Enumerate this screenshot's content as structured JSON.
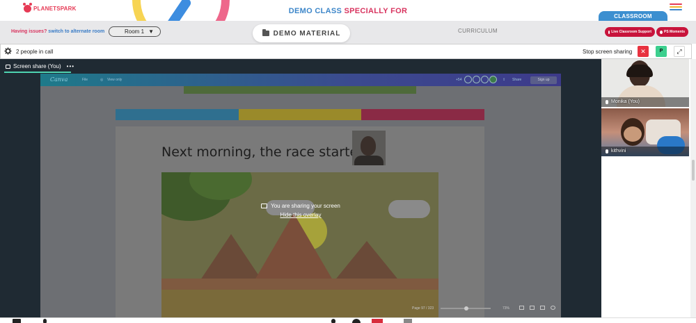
{
  "brand": {
    "logo_text": "PLANETSPARK"
  },
  "header": {
    "title_part1": "DEMO CLASS ",
    "title_part2": "SPECIALLY FOR",
    "classroom_tab": "CLASSROOM"
  },
  "subbar": {
    "issues_text": "Having issues? ",
    "issues_link": "switch to alternate room",
    "room_value": "Room 1",
    "demo_material": "DEMO MATERIAL",
    "curriculum": "CURRICULUM",
    "live_support": "Live Classroom Support",
    "ps_moments": "PS Moments"
  },
  "call": {
    "people_count": "2 people in call",
    "stop_sharing": "Stop screen sharing",
    "close_glyph": "✕",
    "p_button": "P",
    "expand_glyph": "⤢"
  },
  "screenshare": {
    "label": "Screen share (You)",
    "more": "•••",
    "overlay_message": "You are sharing your screen",
    "overlay_link": "Hide this overlay"
  },
  "canva": {
    "logo": "Canva",
    "file": "File",
    "view_only": "View only",
    "count": "+54",
    "share": "Share",
    "sign_up": "Sign up",
    "page_info": "Page 97 / 323",
    "zoom": "73%"
  },
  "slide": {
    "title": "Next morning, the race started!",
    "bar_colors": [
      "#2f6f8f",
      "#9a8a2a",
      "#8a2a45"
    ]
  },
  "participants": [
    {
      "name": "Monika (You)"
    },
    {
      "name": "kithvini"
    }
  ],
  "colors": {
    "brand_red": "#e63a55",
    "title_blue": "#3c86c9",
    "title_pink": "#d8345f",
    "classroom_blue": "#3c8fd0",
    "pill_red": "#c8143c",
    "stage_bg": "#1f2a33",
    "accent_green": "#3ccf8e"
  }
}
